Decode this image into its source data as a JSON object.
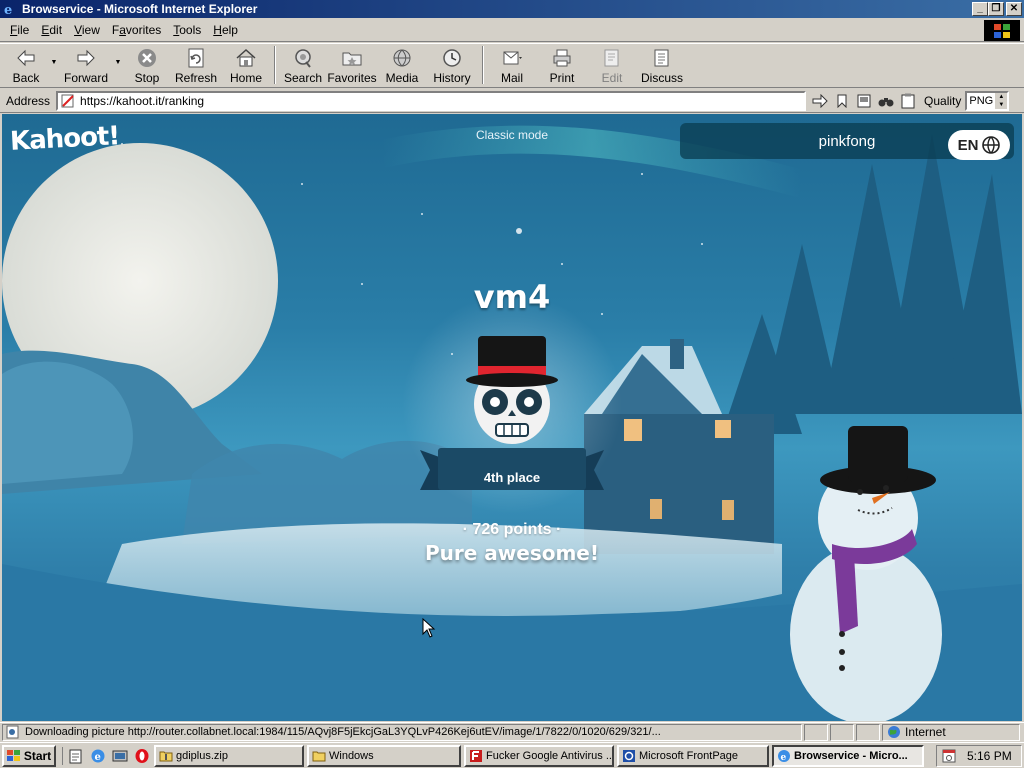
{
  "window": {
    "title": "Browservice - Microsoft Internet Explorer",
    "buttons": [
      "minimize",
      "restore",
      "close"
    ]
  },
  "menubar": {
    "items": [
      {
        "label": "File",
        "key": "F",
        "rest": "ile"
      },
      {
        "label": "Edit",
        "key": "E",
        "rest": "dit"
      },
      {
        "label": "View",
        "key": "V",
        "rest": "iew"
      },
      {
        "label": "Favorites",
        "key": "F",
        "rest": "avorites",
        "pre": "F"
      },
      {
        "label": "Tools",
        "key": "T",
        "rest": "ools"
      },
      {
        "label": "Help",
        "key": "H",
        "rest": "elp"
      }
    ]
  },
  "toolbar": {
    "back": "Back",
    "forward": "Forward",
    "stop": "Stop",
    "refresh": "Refresh",
    "home": "Home",
    "search": "Search",
    "favorites": "Favorites",
    "media": "Media",
    "history": "History",
    "mail": "Mail",
    "print": "Print",
    "edit": "Edit",
    "discuss": "Discuss"
  },
  "addressbar": {
    "label": "Address",
    "url": "https://kahoot.it/ranking",
    "quality_label": "Quality",
    "quality_value": "PNG"
  },
  "page": {
    "logo": "Kahoot!",
    "mode": "Classic mode",
    "username": "pinkfong",
    "language": "EN",
    "player_name": "vm4",
    "place": "4th place",
    "points": "· 726 points ·",
    "praise": "Pure awesome!"
  },
  "statusbar": {
    "text": "Downloading picture http://router.collabnet.local:1984/115/AQvj8F5jEkcjGaL3YQLvP426Kej6utEV/image/1/7822/0/1020/629/321/...",
    "zone": "Internet"
  },
  "taskbar": {
    "start": "Start",
    "tasks": [
      {
        "label": "gdiplus.zip",
        "icon": "zip-folder-icon"
      },
      {
        "label": "Windows",
        "icon": "folder-icon"
      },
      {
        "label": "Fucker Google Antivirus ...",
        "icon": "antivirus-icon"
      },
      {
        "label": "Microsoft FrontPage",
        "icon": "frontpage-icon"
      },
      {
        "label": "Browservice - Micro...",
        "icon": "ie-icon",
        "active": true
      }
    ],
    "clock": "5:16 PM"
  },
  "colors": {
    "titlebar_start": "#0a246a",
    "titlebar_end": "#3a6ea5",
    "scene_sky": "#1f6a93",
    "banner": "#1b4a66",
    "hat_band": "#e0252f",
    "scarf": "#7b3a9a"
  }
}
